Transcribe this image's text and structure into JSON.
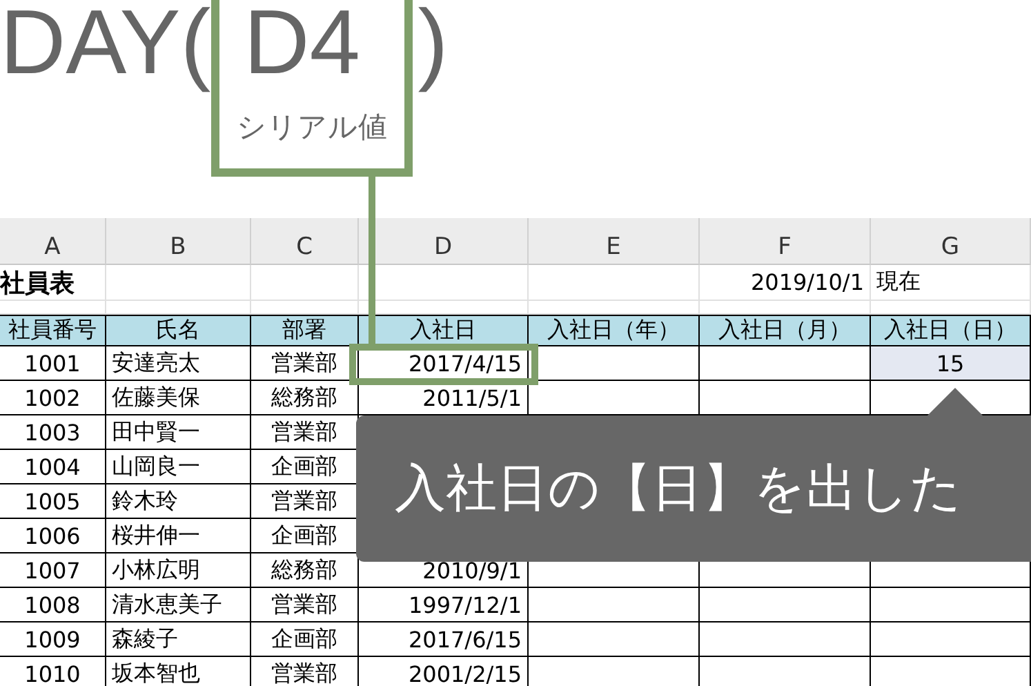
{
  "formula": {
    "function": "DAY(",
    "argument": "D4",
    "close": ")",
    "argument_note": "シリアル値"
  },
  "sheet": {
    "columns": [
      "A",
      "B",
      "C",
      "D",
      "E",
      "F",
      "G"
    ],
    "title": "社員表",
    "as_of_date": "2019/10/1",
    "as_of_label": "現在",
    "headers": [
      "社員番号",
      "氏名",
      "部署",
      "入社日",
      "入社日（年）",
      "入社日（月）",
      "入社日（日）"
    ],
    "rows": [
      {
        "id": "1001",
        "name": "安達亮太",
        "dept": "営業部",
        "hire_date": "2017/4/15",
        "day": {
          "text": "15",
          "selected": true
        }
      },
      {
        "id": "1002",
        "name": "佐藤美保",
        "dept": "総務部",
        "hire_date": "2011/5/1"
      },
      {
        "id": "1003",
        "name": "田中賢一",
        "dept": "営業部"
      },
      {
        "id": "1004",
        "name": "山岡良一",
        "dept": "企画部"
      },
      {
        "id": "1005",
        "name": "鈴木玲",
        "dept": "営業部"
      },
      {
        "id": "1006",
        "name": "桜井伸一",
        "dept": "企画部"
      },
      {
        "id": "1007",
        "name": "小林広明",
        "dept": "総務部",
        "hire_date": "2010/9/1"
      },
      {
        "id": "1008",
        "name": "清水恵美子",
        "dept": "営業部",
        "hire_date": "1997/12/1"
      },
      {
        "id": "1009",
        "name": "森綾子",
        "dept": "企画部",
        "hire_date": "2017/6/15"
      },
      {
        "id": "1010",
        "name": "坂本智也",
        "dept": "営業部",
        "hire_date": "2001/2/15"
      }
    ]
  },
  "callout": {
    "text": "入社日の【日】を出した"
  }
}
